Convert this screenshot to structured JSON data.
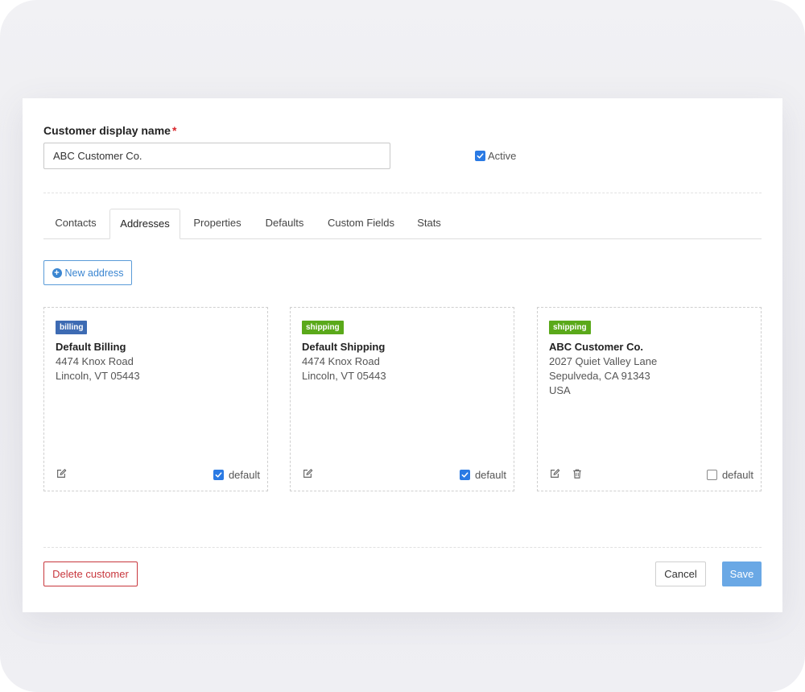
{
  "form": {
    "name_label": "Customer display name",
    "required_mark": "*",
    "name_value": "ABC Customer Co.",
    "active_label": "Active",
    "active_checked": true
  },
  "tabs": [
    {
      "label": "Contacts",
      "active": false
    },
    {
      "label": "Addresses",
      "active": true
    },
    {
      "label": "Properties",
      "active": false
    },
    {
      "label": "Defaults",
      "active": false
    },
    {
      "label": "Custom Fields",
      "active": false
    },
    {
      "label": "Stats",
      "active": false
    }
  ],
  "new_address": {
    "label": "New address",
    "icon": "plus-circle-icon"
  },
  "addresses": [
    {
      "type": "billing",
      "name": "Default Billing",
      "lines": [
        "4474 Knox Road",
        "Lincoln, VT 05443"
      ],
      "default_label": "default",
      "is_default": true,
      "icons": [
        "edit-icon"
      ]
    },
    {
      "type": "shipping",
      "name": "Default Shipping",
      "lines": [
        "4474 Knox Road",
        "Lincoln, VT 05443"
      ],
      "default_label": "default",
      "is_default": true,
      "icons": [
        "edit-icon"
      ]
    },
    {
      "type": "shipping",
      "name": "ABC Customer Co.",
      "lines": [
        "2027 Quiet Valley Lane",
        "Sepulveda, CA 91343",
        "USA"
      ],
      "default_label": "default",
      "is_default": false,
      "icons": [
        "edit-icon",
        "trash-icon"
      ]
    }
  ],
  "footer": {
    "delete_label": "Delete customer",
    "cancel_label": "Cancel",
    "save_label": "Save"
  },
  "colors": {
    "billing_badge": "#3d6bb3",
    "shipping_badge": "#5aa91a",
    "primary": "#2a7ae4",
    "danger": "#c8373d",
    "save_button": "#6aa8e5"
  }
}
